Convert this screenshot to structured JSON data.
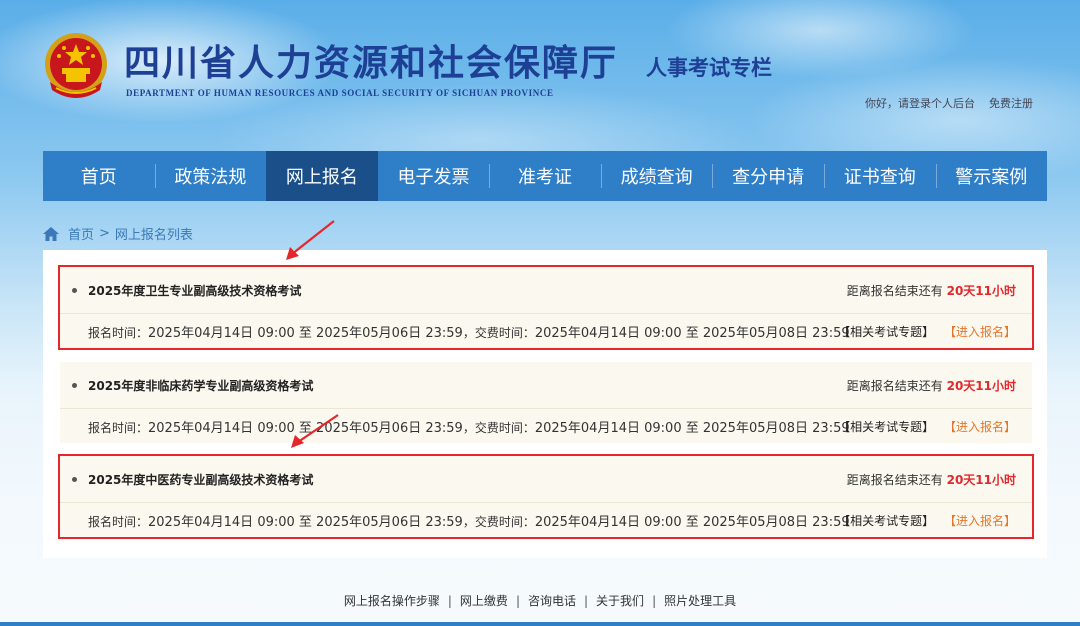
{
  "header": {
    "title": "四川省人力资源和社会保障厅",
    "subtitle": "DEPARTMENT OF HUMAN RESOURCES AND SOCIAL SECURITY OF SICHUAN PROVINCE",
    "column": "人事考试专栏",
    "greeting": "你好，请登录个人后台",
    "register": "免费注册",
    "emblem_icon": "national-emblem-icon"
  },
  "nav": {
    "items": [
      "首页",
      "政策法规",
      "网上报名",
      "电子发票",
      "准考证",
      "成绩查询",
      "查分申请",
      "证书查询",
      "警示案例"
    ],
    "active": "网上报名"
  },
  "breadcrumb": {
    "home": "首页",
    "separator": ">",
    "current": "网上报名列表"
  },
  "exams": [
    {
      "name": "2025年度卫生专业副高级技术资格考试",
      "countdown_label": "距离报名结束还有",
      "remaining": "20天11小时",
      "reg_label": "报名时间：",
      "reg_time": "2025年04月14日 09:00 至 2025年05月06日 23:59",
      "pay_label": "，交费时间：",
      "pay_time": "2025年04月14日 09:00 至 2025年05月08日 23:59",
      "topic_link": "【相关考试专题】",
      "enter_link": "【进入报名】",
      "highlighted": true
    },
    {
      "name": "2025年度非临床药学专业副高级资格考试",
      "countdown_label": "距离报名结束还有",
      "remaining": "20天11小时",
      "reg_label": "报名时间：",
      "reg_time": "2025年04月14日 09:00 至 2025年05月06日 23:59",
      "pay_label": "，交费时间：",
      "pay_time": "2025年04月14日 09:00 至 2025年05月08日 23:59",
      "topic_link": "【相关考试专题】",
      "enter_link": "【进入报名】",
      "highlighted": false
    },
    {
      "name": "2025年度中医药专业副高级技术资格考试",
      "countdown_label": "距离报名结束还有",
      "remaining": "20天11小时",
      "reg_label": "报名时间：",
      "reg_time": "2025年04月14日 09:00 至 2025年05月06日 23:59",
      "pay_label": "，交费时间：",
      "pay_time": "2025年04月14日 09:00 至 2025年05月08日 23:59",
      "topic_link": "【相关考试专题】",
      "enter_link": "【进入报名】",
      "highlighted": true
    }
  ],
  "footer": {
    "links": [
      "网上报名操作步骤",
      "网上缴费",
      "咨询电话",
      "关于我们",
      "照片处理工具"
    ],
    "separator": "|"
  },
  "colors": {
    "nav_bg": "#2f7ec8",
    "nav_active": "#1a4f8a",
    "title": "#1d3f94",
    "highlight": "#e5262b",
    "enter_link": "#e5762b",
    "card_bg": "#fbf8ef"
  }
}
